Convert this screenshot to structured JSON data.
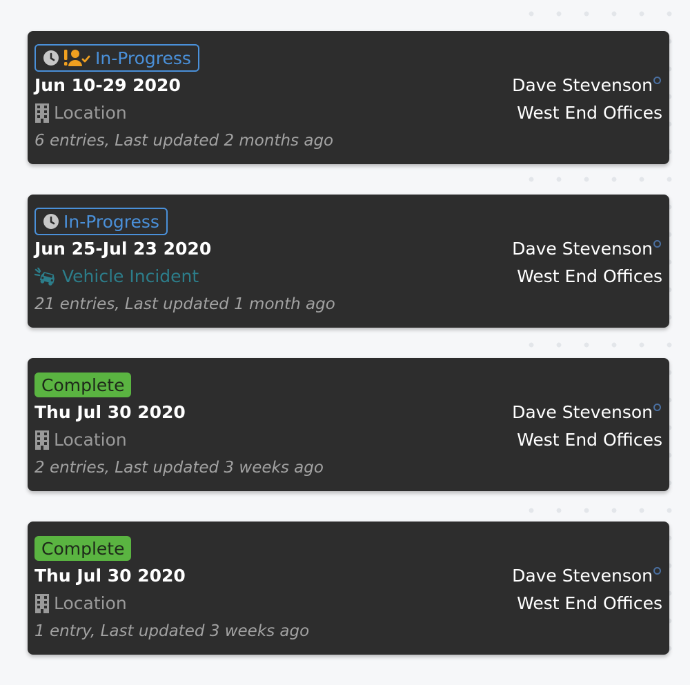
{
  "colors": {
    "card_bg": "#2d2d2d",
    "in_progress": "#4a90d9",
    "complete": "#5ab441",
    "vehicle": "#2c7d8a",
    "assigned_icon": "#f0a020"
  },
  "cards": [
    {
      "status": "In-Progress",
      "status_icons": [
        "clock-icon",
        "user-alert-check-icon"
      ],
      "date": "Jun 10-29 2020",
      "type_icon": "building-icon",
      "type": "Location",
      "meta": "6 entries, Last updated 2 months ago",
      "person": "Dave Stevenson",
      "office": "West End Offices"
    },
    {
      "status": "In-Progress",
      "status_icons": [
        "clock-icon"
      ],
      "date": "Jun 25-Jul 23 2020",
      "type_icon": "car-crash-icon",
      "type": "Vehicle Incident",
      "meta": "21 entries, Last updated 1 month ago",
      "person": "Dave Stevenson",
      "office": "West End Offices"
    },
    {
      "status": "Complete",
      "status_icons": [],
      "date": "Thu Jul 30 2020",
      "type_icon": "building-icon",
      "type": "Location",
      "meta": "2 entries, Last updated 3 weeks ago",
      "person": "Dave Stevenson",
      "office": "West End Offices"
    },
    {
      "status": "Complete",
      "status_icons": [],
      "date": "Thu Jul 30 2020",
      "type_icon": "building-icon",
      "type": "Location",
      "meta": "1 entry, Last updated 3 weeks ago",
      "person": "Dave Stevenson",
      "office": "West End Offices"
    }
  ]
}
